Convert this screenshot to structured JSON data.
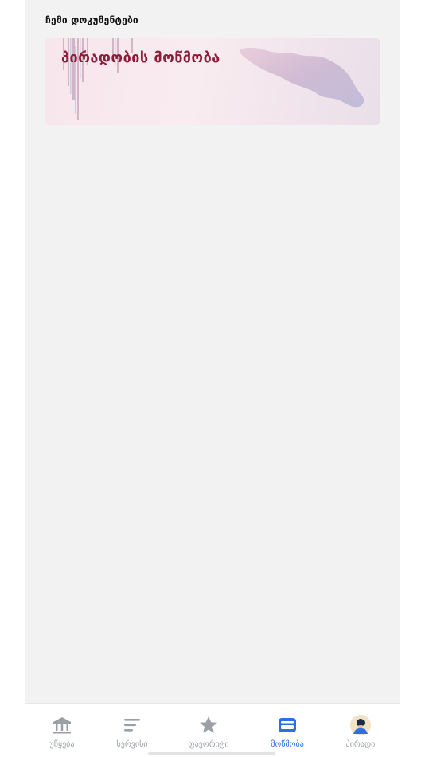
{
  "section": {
    "title": "ჩემი დოკუმენტები"
  },
  "card": {
    "title": "პირადობის მოწმობა"
  },
  "tabs": [
    {
      "label": "უწყება",
      "icon": "bank-icon",
      "active": false
    },
    {
      "label": "სერვისი",
      "icon": "list-icon",
      "active": false
    },
    {
      "label": "ფავორიტი",
      "icon": "star-icon",
      "active": false
    },
    {
      "label": "მოწმობა",
      "icon": "id-card-icon",
      "active": true
    },
    {
      "label": "პირადი",
      "icon": "avatar-icon",
      "active": false
    }
  ],
  "colors": {
    "accent": "#2f6fe0",
    "inactive": "#9aa0a6",
    "card_title": "#8e1b3a",
    "background": "#f2f2f2"
  }
}
